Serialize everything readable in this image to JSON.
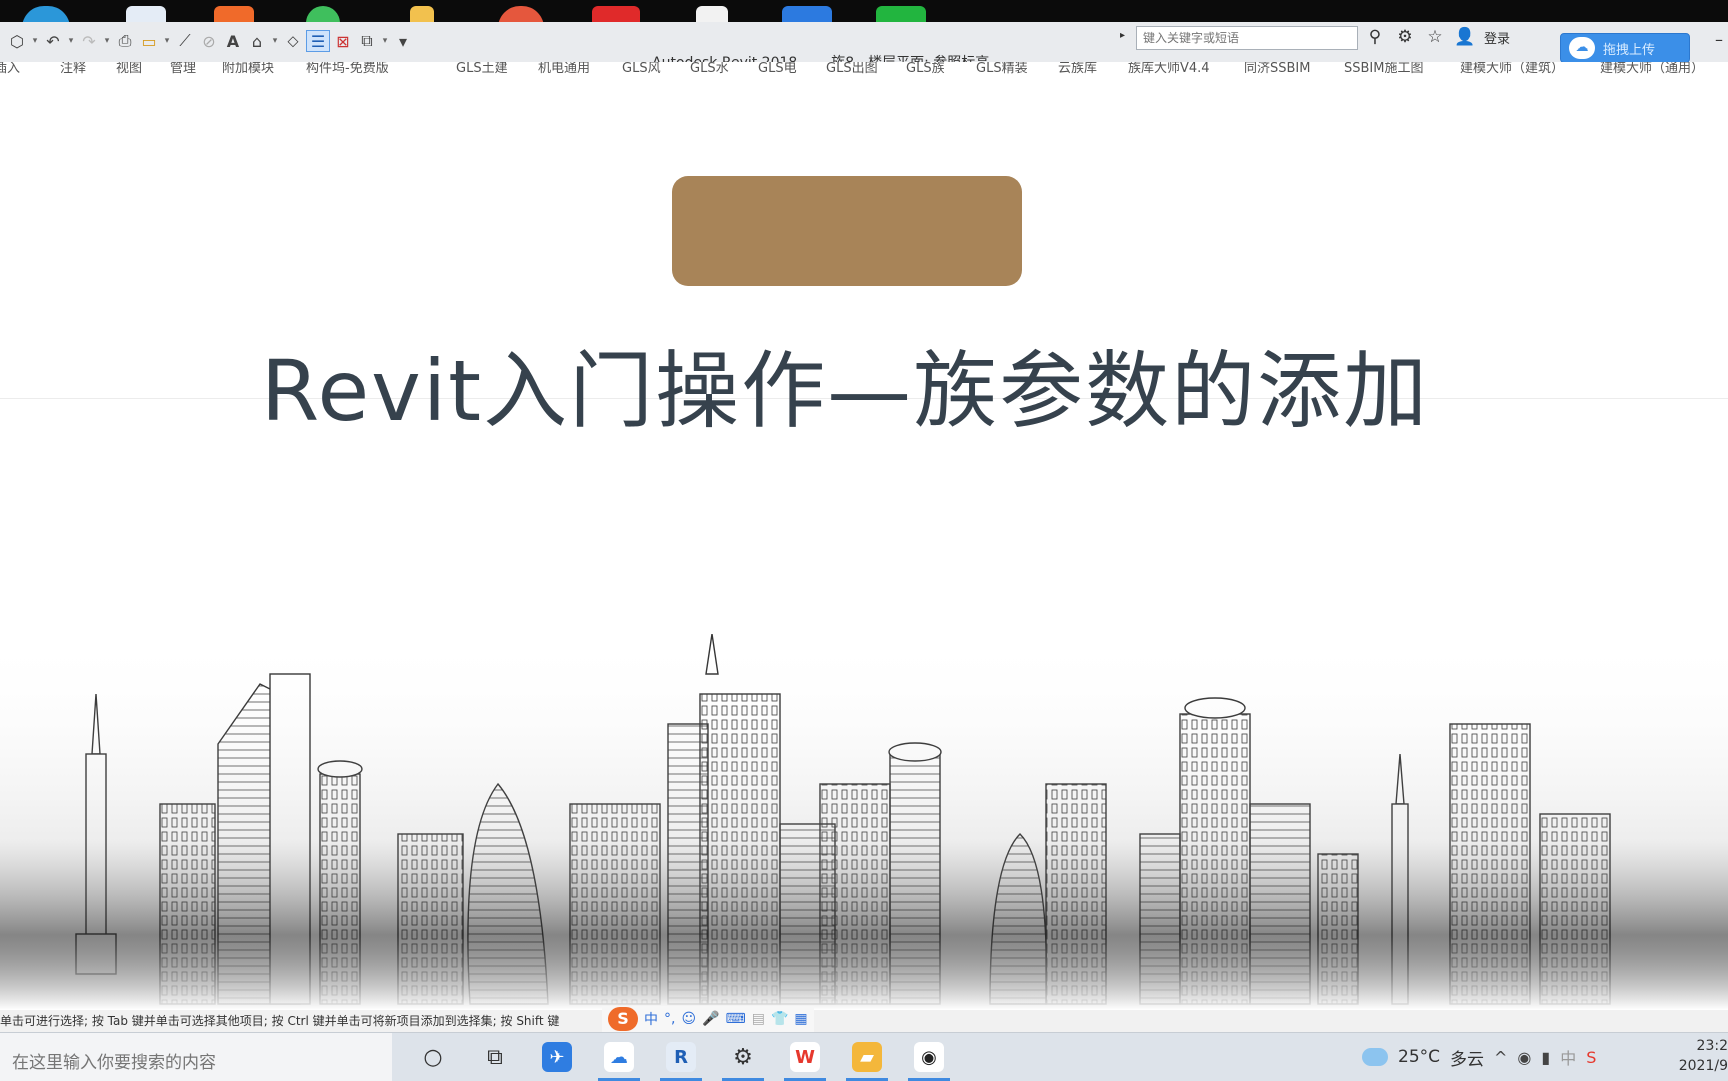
{
  "window": {
    "app_name": "Autodesk Revit 2018 -",
    "view_title": "族8 - 楼层平面: 参照标高",
    "search_placeholder": "键入关键字或短语",
    "login_label": "登录",
    "upload_label": "拖拽上传"
  },
  "ribbon_tabs": [
    "插入",
    "注释",
    "视图",
    "管理",
    "附加模块",
    "构件坞-免费版",
    "GLS土建",
    "机电通用",
    "GLS风",
    "GLS水",
    "GLS电",
    "GLS出图",
    "GLS族",
    "GLS精装",
    "云族库",
    "族库大师V4.4",
    "同济SSBIM",
    "SSBIM施工图",
    "建模大师（建筑）",
    "建模大师（通用）"
  ],
  "slide": {
    "title": "Revit入门操作—族参数的添加",
    "badge_color": "#a88458",
    "title_color": "#36424d"
  },
  "status_bar": {
    "message": "单击可进行选择; 按 Tab 键并单击可选择其他项目; 按 Ctrl 键并单击可将新项目添加到选择集; 按 Shift 键"
  },
  "ime_bar": {
    "mode": "中"
  },
  "taskbar": {
    "search_placeholder": "在这里输入你要搜索的内容",
    "apps": [
      {
        "name": "cortana-icon",
        "glyph": "○"
      },
      {
        "name": "task-view-icon",
        "glyph": "⧉"
      },
      {
        "name": "feishu-icon",
        "glyph": "✈",
        "color": "#2f7de1"
      },
      {
        "name": "baidu-netdisk-icon",
        "glyph": "☁",
        "color": "#ffffff",
        "running": true
      },
      {
        "name": "revit-icon",
        "glyph": "R",
        "color": "#1f5fb5",
        "running": true
      },
      {
        "name": "settings-icon",
        "glyph": "⚙",
        "running": true
      },
      {
        "name": "wps-icon",
        "glyph": "W",
        "color": "#e6382d",
        "running": true
      },
      {
        "name": "file-explorer-icon",
        "glyph": "▰",
        "color": "#f4b73b",
        "running": true
      },
      {
        "name": "qq-icon",
        "glyph": "🐧",
        "color": "#ffffff",
        "running": true
      }
    ],
    "weather_temp": "25°C",
    "weather_desc": "多云",
    "ime_indicator": "中",
    "clock_time": "23:2",
    "clock_date": "2021/9"
  }
}
